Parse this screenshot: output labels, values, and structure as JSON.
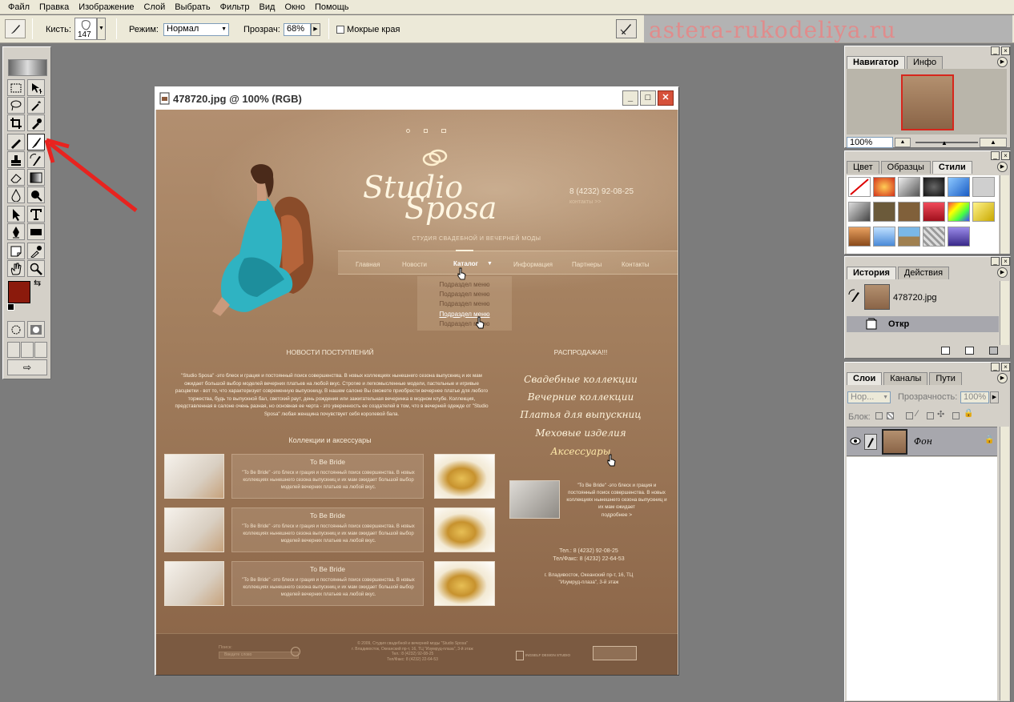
{
  "menu": [
    "Файл",
    "Правка",
    "Изображение",
    "Слой",
    "Выбрать",
    "Фильтр",
    "Вид",
    "Окно",
    "Помощь"
  ],
  "options": {
    "brush_label": "Кисть:",
    "brush_size": "147",
    "mode_label": "Режим:",
    "mode_value": "Нормал",
    "opacity_label": "Прозрач:",
    "opacity_value": "68%",
    "wet_edges_label": "Мокрые края"
  },
  "watermark": "astera-rukodeliya.ru",
  "document": {
    "title": "478720.jpg @ 100% (RGB)",
    "site": {
      "logo_line1": "Studio",
      "logo_line2": "Sposa",
      "phone": "8 (4232) 92-08-25",
      "contacts_link": "контакты >>",
      "tagline": "СТУДИЯ СВАДЕБНОЙ И ВЕЧЕРНЕЙ МОДЫ",
      "nav": [
        "Главная",
        "Новости",
        "Каталог",
        "Информация",
        "Партнеры",
        "Контакты"
      ],
      "submenu": [
        "Подраздел меню",
        "Подраздел меню",
        "Подраздел меню",
        "Подраздел меню",
        "Подраздел меню"
      ],
      "news_title": "НОВОСТИ ПОСТУПЛЕНИЙ",
      "news_text": "\"Studio Sposa\" -это блеск и грация и постоянный поиск совершенства. В новых коллекциях нынешнего сезона выпускниц и их мам ожидает большой выбор моделей вечерних платьев на любой вкус. Строгие и легкомысленные модели, пастельные и игривые расцветки - вот то, что характеризует современную выпускницу. В нашем салоне Вы сможете приобрести вечернее платье для любого торжества, будь то выпускной бал, светский раут, день рождения или зажигательная вечеринка в модном клубе. Коллекция, представленная в салоне очень разная, но основная ее черта - это уверенность ее создателей в том, что в вечерней одежде от \"Studio Sposa\" любая женщина почувствует себя королевой бала.",
      "sale_title": "РАСПРОДАЖА!!!",
      "sale_links": [
        "Свадебные коллекции",
        "Вечерние коллекции",
        "Платья для выпускниц",
        "Меховые изделия",
        "Аксессуары"
      ],
      "collections_title": "Коллекции и аксессуары",
      "cards": [
        {
          "title": "To Be Bride",
          "text": "\"To Be Bride\" -это блеск и грация и постоянный поиск совершенства. В новых коллекциях нынешнего сезона выпускниц и их мам ожидает большой выбор моделей вечерних платьев на любой вкус."
        },
        {
          "title": "To Be Bride",
          "text": "\"To Be Bride\" -это блеск и грация и постоянный поиск совершенства. В новых коллекциях нынешнего сезона выпускниц и их мам ожидает большой выбор моделей вечерних платьев на любой вкус."
        },
        {
          "title": "To Be Bride",
          "text": "\"To Be Bride\" -это блеск и грация и постоянный поиск совершенства. В новых коллекциях нынешнего сезона выпускниц и их мам ожидает большой выбор моделей вечерних платьев на любой вкус."
        }
      ],
      "promo_text": "\"To Be Bride\" -это блеск и грация и постоянный поиск совершенства. В новых коллекциях нынешнего сезона выпускниц и их мам ожидает",
      "promo_more": "подробнее >",
      "contact_tel": "Тел.: 8 (4232) 92-08-25",
      "contact_fax": "Тел/Факс: 8 (4232) 22-64-53",
      "address1": "г. Владивосток, Океанский пр-т, 16, ТЦ",
      "address2": "\"Изумруд-плаза\", 3-й этаж",
      "footer_search_label": "Поиск:",
      "footer_search_placeholder": "Введите слово",
      "footer_copy1": "© 2009, Студия свадебной и вечерней моды \"Studio Sposa\"",
      "footer_copy2": "г. Владивосток, Океанский пр-т, 16, ТЦ \"Изумруд-плаза\", 3-й этаж",
      "footer_copy3": "Тел.: 8 (4232) 92-08-25",
      "footer_copy4": "Тел/Факс: 8 (4232) 22-64-53",
      "footer_studio": "INGSELF DESIGN STUDIO"
    }
  },
  "navigator": {
    "tabs": [
      "Навигатор",
      "Инфо"
    ],
    "zoom": "100%"
  },
  "color_panel": {
    "tabs": [
      "Цвет",
      "Образцы",
      "Стили"
    ]
  },
  "history": {
    "tabs": [
      "История",
      "Действия"
    ],
    "snapshot": "478720.jpg",
    "step": "Откр"
  },
  "layers": {
    "tabs": [
      "Слои",
      "Каналы",
      "Пути"
    ],
    "blend": "Нор...",
    "opacity_label": "Прозрачность:",
    "opacity_value": "100%",
    "lock_label": "Блок:",
    "layer_name": "Фон"
  },
  "colors": {
    "foreground": "#8b1a0c",
    "background": "#ffffff",
    "annotation": "#e8231f"
  }
}
